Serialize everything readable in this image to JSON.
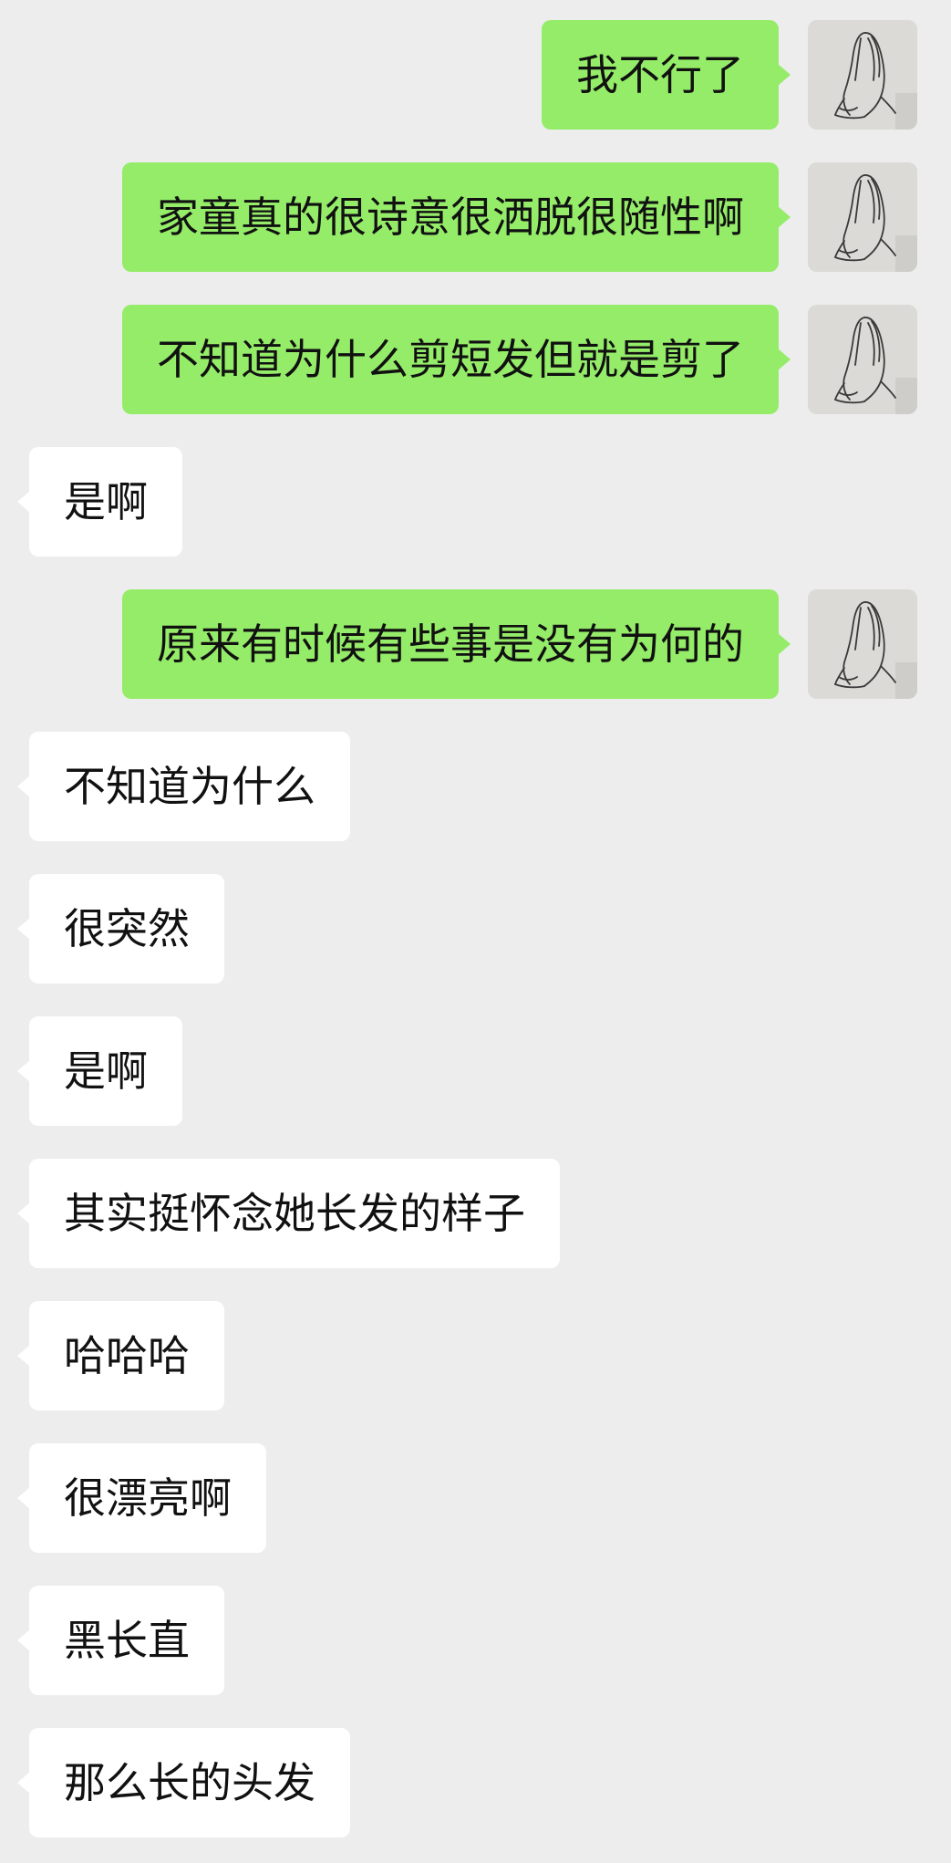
{
  "messages": [
    {
      "side": "out",
      "text": "我不行了",
      "avatar_icon": "praying-hands-icon"
    },
    {
      "side": "out",
      "text": "家童真的很诗意很洒脱很随性啊",
      "avatar_icon": "praying-hands-icon"
    },
    {
      "side": "out",
      "text": "不知道为什么剪短发但就是剪了",
      "avatar_icon": "praying-hands-icon"
    },
    {
      "side": "in",
      "text": "是啊"
    },
    {
      "side": "out",
      "text": "原来有时候有些事是没有为何的",
      "avatar_icon": "praying-hands-icon"
    },
    {
      "side": "in",
      "text": "不知道为什么"
    },
    {
      "side": "in",
      "text": "很突然"
    },
    {
      "side": "in",
      "text": "是啊"
    },
    {
      "side": "in",
      "text": "其实挺怀念她长发的样子"
    },
    {
      "side": "in",
      "text": "哈哈哈"
    },
    {
      "side": "in",
      "text": "很漂亮啊"
    },
    {
      "side": "in",
      "text": "黑长直"
    },
    {
      "side": "in",
      "text": "那么长的头发"
    }
  ],
  "colors": {
    "background": "#ededed",
    "outgoing_bubble": "#95ec69",
    "incoming_bubble": "#ffffff",
    "text": "#111111"
  }
}
